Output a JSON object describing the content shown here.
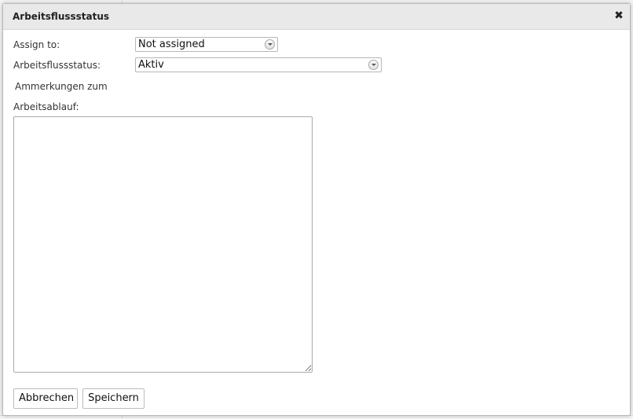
{
  "dialog": {
    "title": "Arbeitsflussstatus",
    "close_icon": "close-icon"
  },
  "form": {
    "assign_label": "Assign to:",
    "assign_value": "Not assigned",
    "status_label": "Arbeitsflussstatus:",
    "status_value": "Aktiv",
    "notes_label_line1": "Ammerkungen zum",
    "notes_label_line2": "Arbeitsablauf:",
    "notes_value": ""
  },
  "buttons": {
    "cancel_label": "Abbrechen",
    "save_label": "Speichern"
  }
}
